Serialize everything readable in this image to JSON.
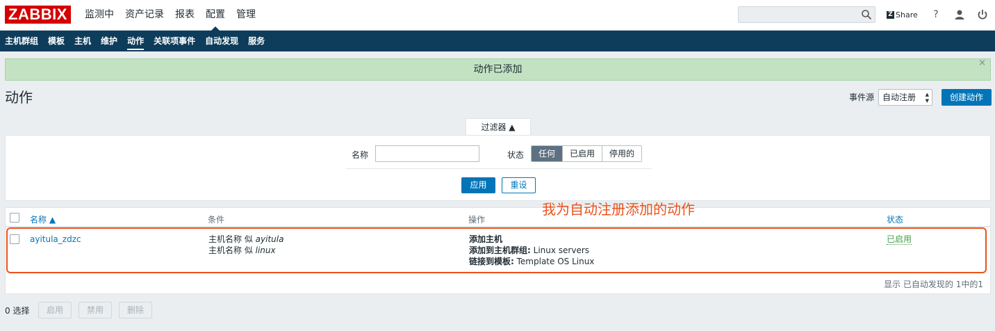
{
  "header": {
    "logo_text": "ZABBIX",
    "menu": [
      "监测中",
      "资产记录",
      "报表",
      "配置",
      "管理"
    ],
    "selected_menu_index": 3,
    "share_label": "Share",
    "share_badge": "Z",
    "help_glyph": "?"
  },
  "subnav": {
    "items": [
      "主机群组",
      "模板",
      "主机",
      "维护",
      "动作",
      "关联项事件",
      "自动发现",
      "服务"
    ],
    "selected_index": 4
  },
  "message": {
    "text": "动作已添加",
    "close_glyph": "×"
  },
  "page": {
    "title": "动作",
    "event_source_label": "事件源",
    "event_source_value": "自动注册",
    "create_button": "创建动作"
  },
  "filter": {
    "tab_label": "过滤器 ▲",
    "name_label": "名称",
    "name_value": "",
    "status_label": "状态",
    "status_options": [
      "任何",
      "已启用",
      "停用的"
    ],
    "status_selected": 0,
    "apply_button": "应用",
    "reset_button": "重设"
  },
  "table": {
    "headers": {
      "name": "名称 ▲",
      "conditions": "条件",
      "operations": "操作",
      "status": "状态"
    },
    "rows": [
      {
        "name": "ayitula_zdzc",
        "cond1_prefix": "主机名称 似 ",
        "cond1_value": "ayitula",
        "cond2_prefix": "主机名称 似 ",
        "cond2_value": "linux",
        "op1": "添加主机",
        "op2_label": "添加到主机群组:",
        "op2_value": " Linux servers",
        "op3_label": "链接到模板:",
        "op3_value": " Template OS Linux",
        "status": "已启用"
      }
    ],
    "footer": "显示 已自动发现的 1中的1"
  },
  "annotation": {
    "text": "我为自动注册添加的动作",
    "color": "#e9531c"
  },
  "bottom": {
    "selected_count": "0 选择",
    "enable_button": "启用",
    "disable_button": "禁用",
    "delete_button": "删除"
  },
  "colors": {
    "brand_red": "#d40000",
    "nav_blue": "#0e3c5b",
    "accent_blue": "#0275b8",
    "success_green": "#429e47"
  }
}
